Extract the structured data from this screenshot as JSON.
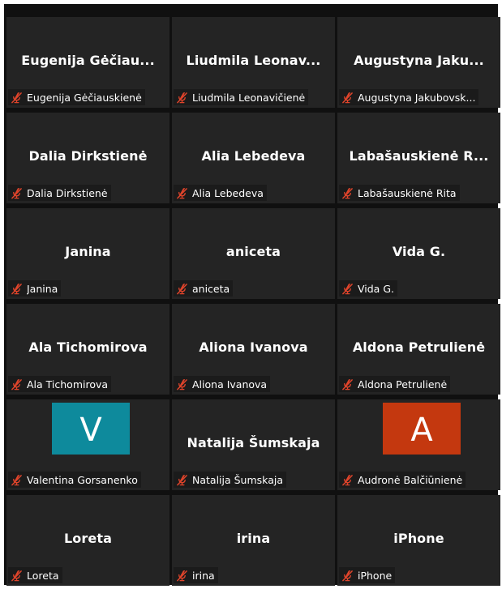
{
  "participants": [
    {
      "name": "Eugenija  Gėčiau...",
      "label": "Eugenija Gėčiauskienė",
      "muted": true
    },
    {
      "name": "Liudmila  Leonav...",
      "label": "Liudmila Leonavičienė",
      "muted": true
    },
    {
      "name": "Augustyna  Jaku...",
      "label": "Augustyna Jakubovsk...",
      "muted": true
    },
    {
      "name": "Dalia Dirkstienė",
      "label": "Dalia Dirkstienė",
      "muted": true
    },
    {
      "name": "Alia Lebedeva",
      "label": "Alia Lebedeva",
      "muted": true
    },
    {
      "name": "Labašauskienė  R...",
      "label": "Labašauskienė Rita",
      "muted": true
    },
    {
      "name": "Janina",
      "label": "Janina",
      "muted": true
    },
    {
      "name": "aniceta",
      "label": "aniceta",
      "muted": true
    },
    {
      "name": "Vida G.",
      "label": "Vida G.",
      "muted": true
    },
    {
      "name": "Ala Tichomirova",
      "label": "Ala Tichomirova",
      "muted": true
    },
    {
      "name": "Aliona Ivanova",
      "label": "Aliona Ivanova",
      "muted": true
    },
    {
      "name": "Aldona Petrulienė",
      "label": "Aldona Petrulienė",
      "muted": true
    },
    {
      "avatar_letter": "V",
      "avatar_color": "#0e8a9c",
      "label": "Valentina Gorsanenko",
      "muted": true
    },
    {
      "name": "Natalija Šumskaja",
      "label": "Natalija Šumskaja",
      "muted": true
    },
    {
      "avatar_letter": "A",
      "avatar_color": "#c4380f",
      "label": "Audronė Balčiūnienė",
      "muted": true
    },
    {
      "name": "Loreta",
      "label": "Loreta",
      "muted": true
    },
    {
      "name": "irina",
      "label": "irina",
      "muted": true
    },
    {
      "name": "iPhone",
      "label": "iPhone",
      "muted": true
    }
  ],
  "colors": {
    "background": "#101010",
    "tile": "#242424",
    "label_bg": "#1b1b1b",
    "mute_icon": "#e0442b",
    "text": "#ffffff"
  },
  "icons": {
    "mute": "microphone-muted-icon"
  }
}
